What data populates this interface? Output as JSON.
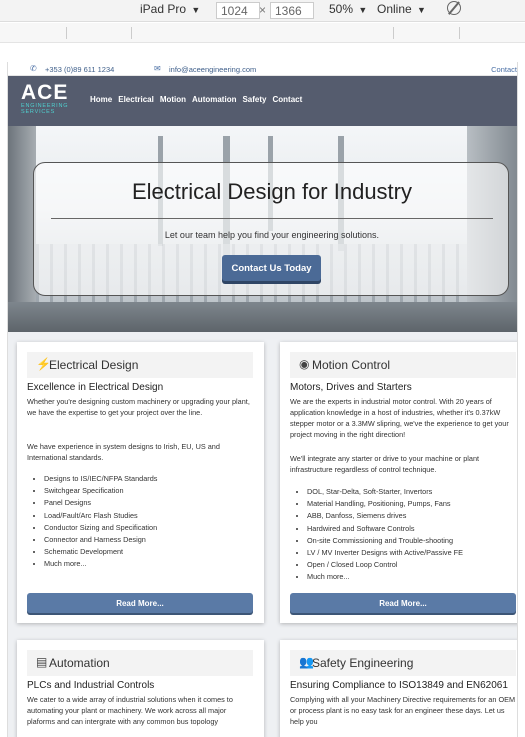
{
  "devtools": {
    "device": "iPad Pro",
    "width": "1024",
    "height": "1366",
    "separator": "×",
    "zoom": "50%",
    "network": "Online",
    "caret": "▼"
  },
  "topbar": {
    "phone": "+353 (0)89 611 1234",
    "email": "info@aceengineering.com",
    "contact": "Contact"
  },
  "logo": {
    "main": "ACE",
    "sub1": "ENGINEERING",
    "sub2": "SERVICES"
  },
  "nav": [
    "Home",
    "Electrical",
    "Motion",
    "Automation",
    "Safety",
    "Contact"
  ],
  "hero": {
    "title": "Electrical Design for Industry",
    "subtitle": "Let our team help you find your engineering solutions.",
    "button": "Contact Us Today"
  },
  "cards": [
    {
      "icon": "⚡",
      "title": "Electrical Design",
      "subtitle": "Excellence in Electrical Design",
      "paragraphs": [
        "Whether you're designing custom machinery or upgrading your plant, we have the expertise to get your project over the line.",
        "We have experience in system designs to Irish, EU, US and International standards."
      ],
      "items": [
        "Designs to IS/IEC/NFPA Standards",
        "Switchgear Specification",
        "Panel Designs",
        "Load/Fault/Arc Flash Studies",
        "Conductor Sizing and Specification",
        "Connector and Harness Design",
        "Schematic Development",
        "Much more..."
      ],
      "button": "Read More..."
    },
    {
      "icon": "◉",
      "title": "Motion Control",
      "subtitle": "Motors, Drives and Starters",
      "paragraphs": [
        "We are the experts in industrial motor control. With 20 years of application knowledge in a host of industries, whether it's 0.37kW stepper motor or a 3.3MW slipring, we've the experience to get your project moving in the right direction!",
        "We'll integrate any starter or drive to your machine or plant infrastructure regardless of control technique."
      ],
      "items": [
        "DOL, Star-Delta, Soft-Starter, Invertors",
        "Material Handling, Positioning, Pumps, Fans",
        "ABB, Danfoss, Siemens drives",
        "Hardwired and Software Controls",
        "On-site Commissioning and Trouble-shooting",
        "LV / MV Inverter Designs with Active/Passive FE",
        "Open / Closed Loop Control",
        "Much more..."
      ],
      "button": "Read More..."
    },
    {
      "icon": "▤",
      "title": "Automation",
      "subtitle": "PLCs and Industrial Controls",
      "paragraphs": [
        "We cater to a wide array of industrial solutions when it comes to automating your plant or machinery. We work across all major plaforms and can intergrate with any common bus topology"
      ]
    },
    {
      "icon": "👥",
      "title": "Safety Engineering",
      "subtitle": "Ensuring Compliance to ISO13849 and EN62061",
      "paragraphs": [
        "Complying with all your Machinery Directive requirements for an OEM or process plant is no easy task for an engineer these days. Let us help you"
      ]
    }
  ]
}
